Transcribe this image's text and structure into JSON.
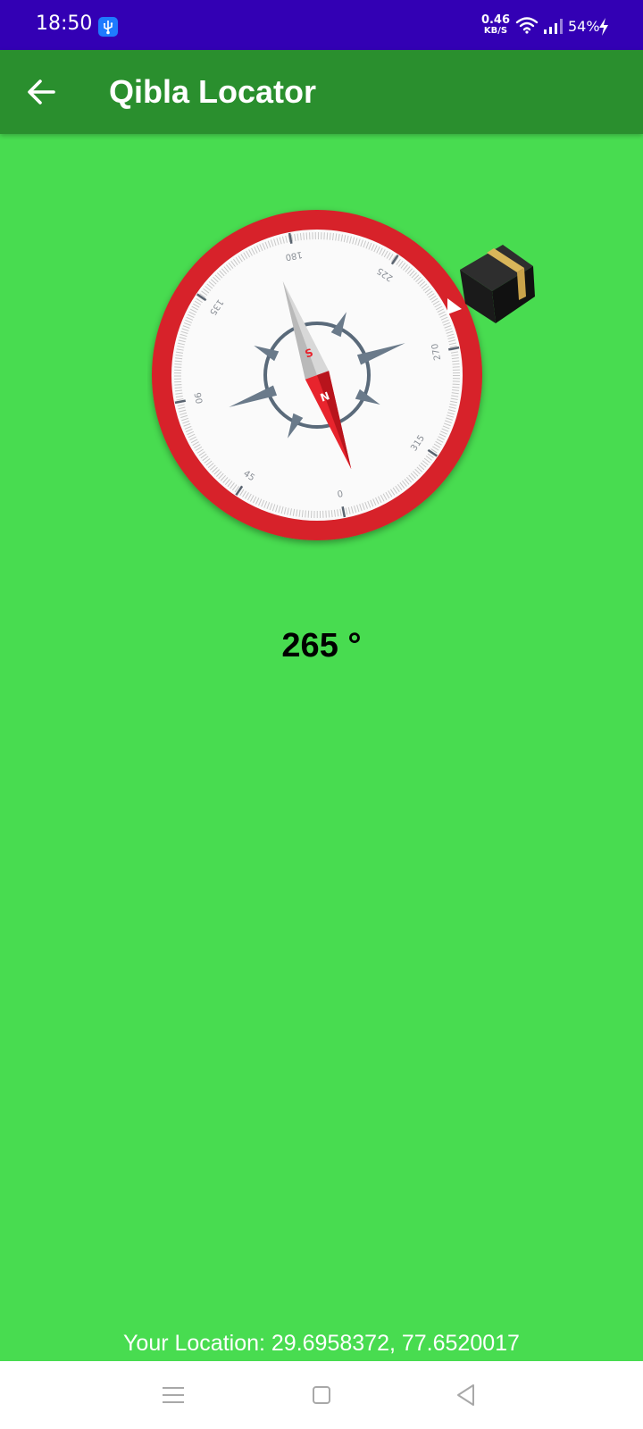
{
  "status_bar": {
    "time": "18:50",
    "net_speed_value": "0.46",
    "net_speed_unit": "KB/S",
    "battery": "54%",
    "icons": [
      "usb-debug-icon",
      "wifi-icon",
      "signal-icon",
      "charging-icon"
    ]
  },
  "app_bar": {
    "title": "Qibla Locator",
    "back_icon": "arrow-left-icon"
  },
  "compass": {
    "dial_labels": [
      "180",
      "225",
      "270",
      "315",
      "0",
      "45",
      "90",
      "135"
    ],
    "needle_labels": [
      "S",
      "N"
    ],
    "qibla_icon": "kaaba-icon"
  },
  "heading": {
    "text": "265 °"
  },
  "location": {
    "text": "Your Location: 29.6958372, 77.6520017"
  },
  "nav_bar": {
    "icons": [
      "menu-icon",
      "home-icon",
      "back-triangle-icon"
    ]
  },
  "colors": {
    "status_bar": "#3300b4",
    "app_bar": "#2a8f2e",
    "background": "#48dc50",
    "compass_ring": "#d7202a",
    "needle_north": "#e8242d"
  }
}
